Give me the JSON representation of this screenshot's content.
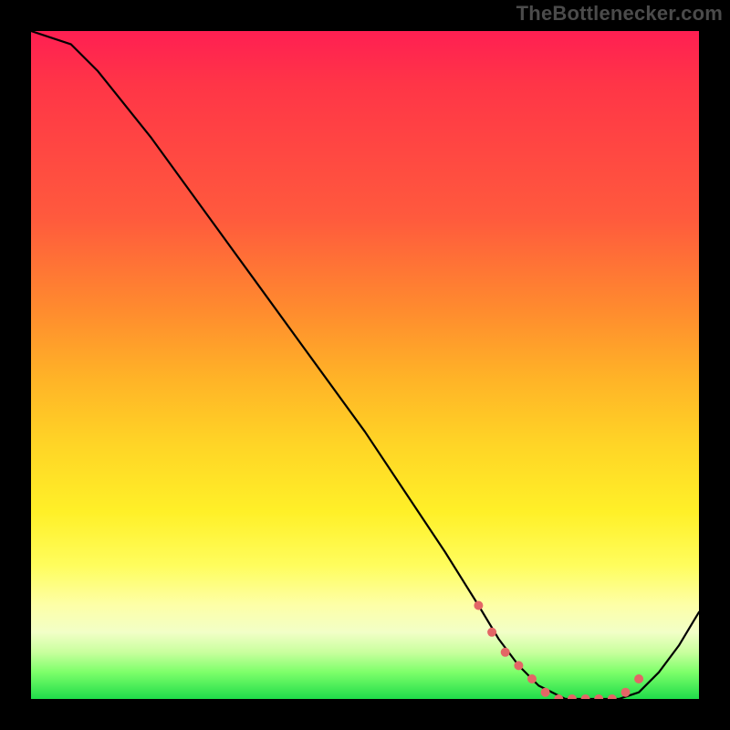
{
  "watermark": "TheBottlenecker.com",
  "chart_data": {
    "type": "line",
    "title": "",
    "xlabel": "",
    "ylabel": "",
    "xlim": [
      0,
      100
    ],
    "ylim": [
      0,
      100
    ],
    "x": [
      0,
      6,
      10,
      18,
      26,
      34,
      42,
      50,
      56,
      62,
      67,
      70,
      73,
      76,
      80,
      84,
      88,
      91,
      94,
      97,
      100
    ],
    "values": [
      100,
      98,
      94,
      84,
      73,
      62,
      51,
      40,
      31,
      22,
      14,
      9,
      5,
      2,
      0,
      0,
      0,
      1,
      4,
      8,
      13
    ],
    "marker_segment": {
      "color": "#e36666",
      "points_x": [
        67,
        69,
        71,
        73,
        75,
        77,
        79,
        81,
        83,
        85,
        87,
        89,
        91
      ],
      "points_y": [
        14,
        10,
        7,
        5,
        3,
        1,
        0,
        0,
        0,
        0,
        0,
        1,
        3
      ]
    }
  }
}
